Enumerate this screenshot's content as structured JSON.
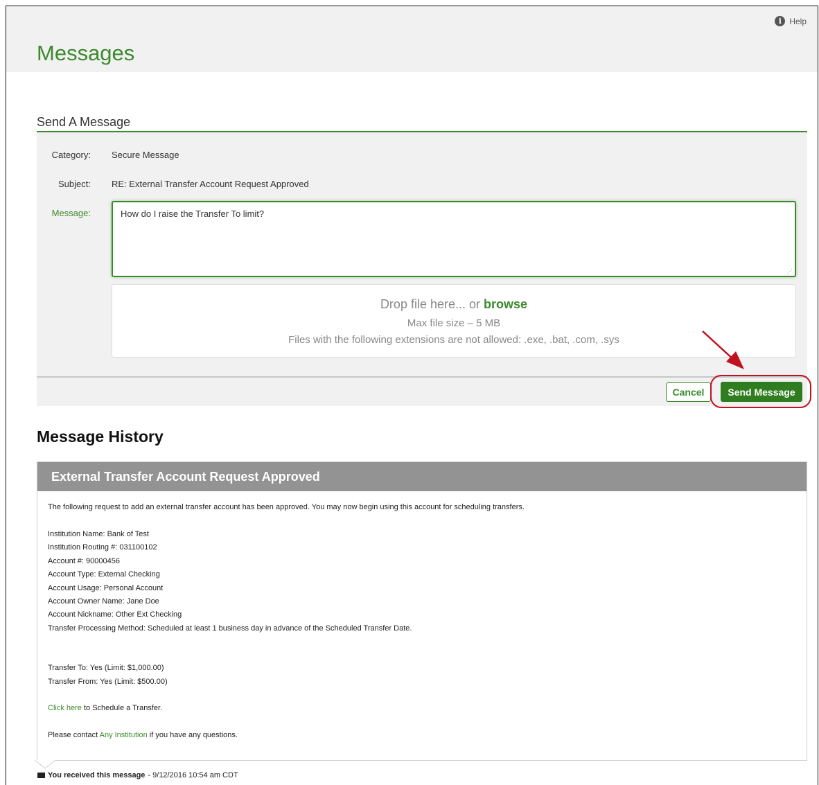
{
  "header": {
    "title": "Messages",
    "help_label": "Help"
  },
  "compose": {
    "section_title": "Send A Message",
    "category_label": "Category:",
    "category_value": "Secure Message",
    "subject_label": "Subject:",
    "subject_value": "RE: External Transfer Account Request Approved",
    "message_label": "Message:",
    "message_value": "How do I raise the Transfer To limit?",
    "drop_prefix": "Drop file here... or",
    "drop_browse": "browse",
    "drop_max": "Max file size – 5 MB",
    "drop_ext": "Files with the following extensions are not allowed: .exe, .bat, .com, .sys",
    "cancel_label": "Cancel",
    "send_label": "Send Message"
  },
  "history": {
    "title": "Message History",
    "card_title": "External Transfer Account Request Approved",
    "intro": "The following request to add an external transfer account has been approved. You may now begin using this account for scheduling transfers.",
    "details": [
      "Institution Name: Bank of Test",
      "Institution Routing #: 031100102",
      "Account #: 90000456",
      "Account Type: External Checking",
      "Account Usage: Personal Account",
      "Account Owner Name: Jane Doe",
      "Account Nickname: Other Ext Checking",
      "Transfer Processing Method: Scheduled at least 1 business day in advance of the Scheduled Transfer Date."
    ],
    "limits": [
      "Transfer To: Yes (Limit: $1,000.00)",
      "Transfer From: Yes (Limit: $500.00)"
    ],
    "click_link": "Click here",
    "click_rest": "to Schedule a Transfer.",
    "contact_prefix": "Please contact",
    "contact_link": "Any Institution",
    "contact_suffix": "if you have any questions.",
    "received_label": "You received this message",
    "received_date": "- 9/12/2016 10:54 am CDT"
  },
  "colors": {
    "accent": "#3b8a2c",
    "send_button": "#2f7d1f",
    "annotation": "#c1121f",
    "card_header": "#939393"
  }
}
